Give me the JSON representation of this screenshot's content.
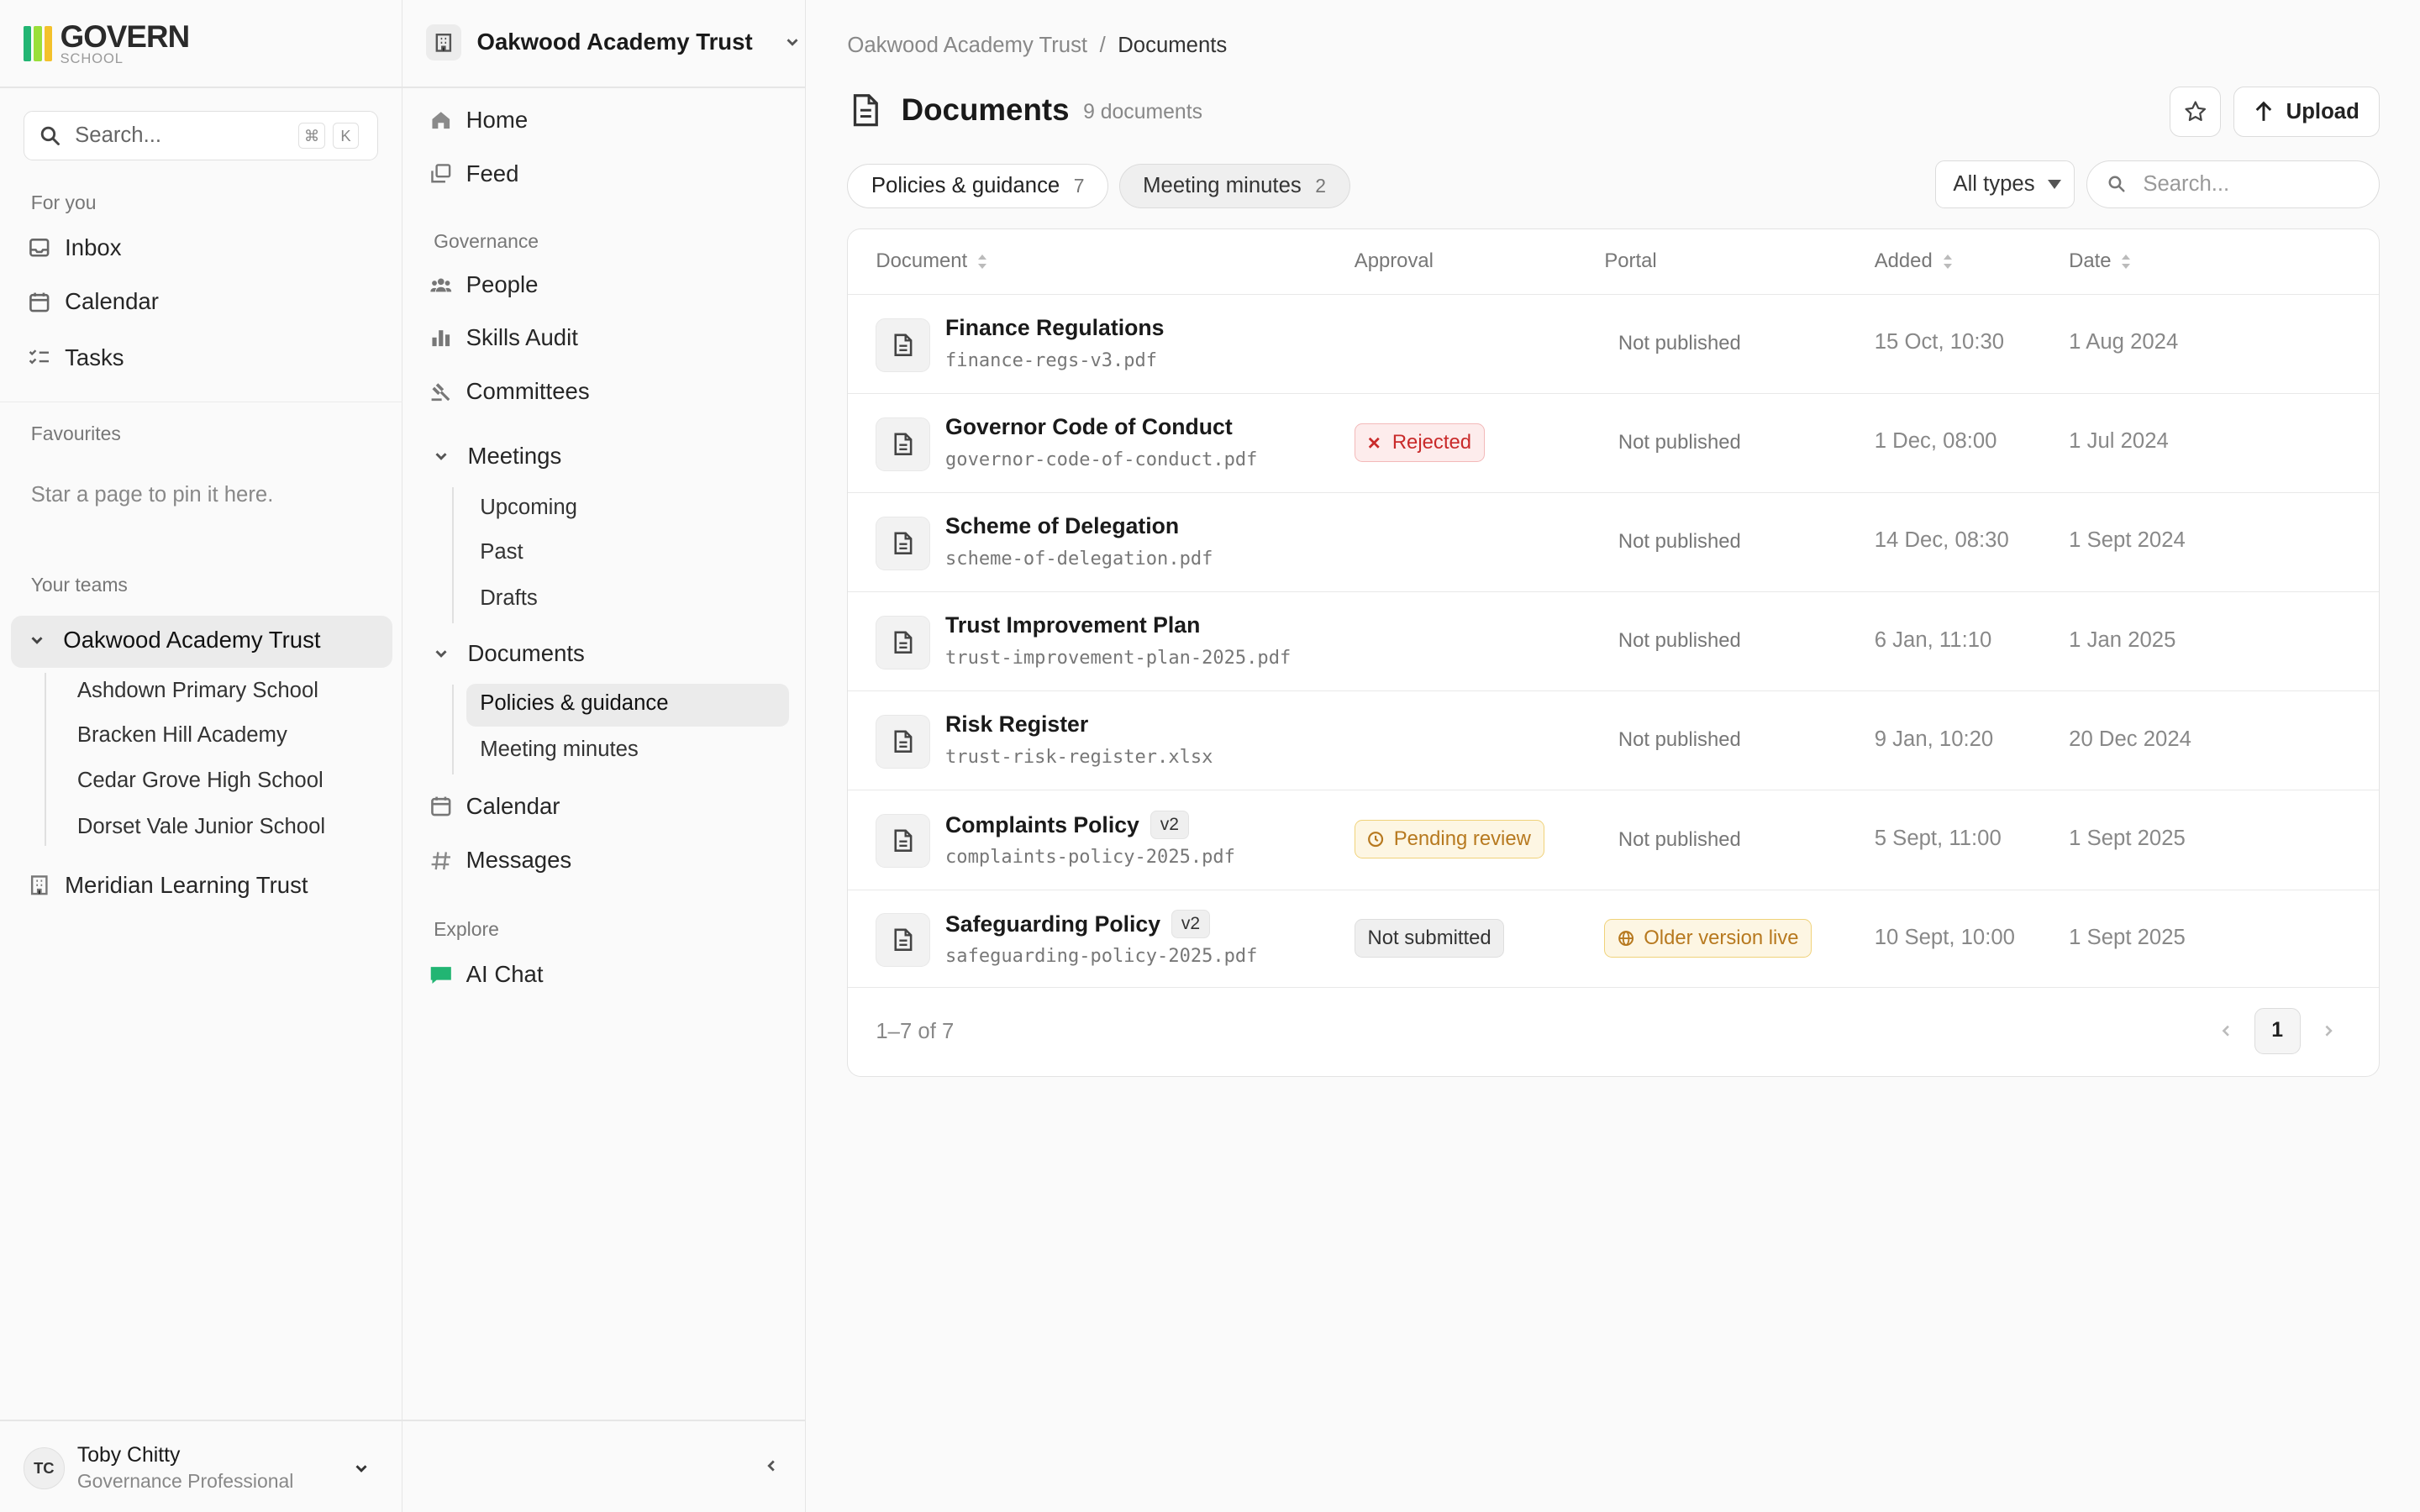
{
  "brand": {
    "name": "GOVERN",
    "sub": "SCHOOL",
    "colors": [
      "#22b573",
      "#9adf3a",
      "#f3c12b"
    ]
  },
  "search": {
    "placeholder": "Search...",
    "kbd1": "⌘",
    "kbd2": "K"
  },
  "sidebar": {
    "for_you_label": "For you",
    "for_you": [
      {
        "label": "Inbox",
        "icon": "inbox-icon"
      },
      {
        "label": "Calendar",
        "icon": "calendar-icon"
      },
      {
        "label": "Tasks",
        "icon": "tasks-icon"
      }
    ],
    "favourites_label": "Favourites",
    "favourites_empty": "Star a page to pin it here.",
    "teams_label": "Your teams",
    "teams": [
      {
        "label": "Oakwood Academy Trust",
        "expanded": true,
        "children": [
          "Ashdown Primary School",
          "Bracken Hill Academy",
          "Cedar Grove High School",
          "Dorset Vale Junior School"
        ]
      },
      {
        "label": "Meridian Learning Trust",
        "expanded": false
      }
    ]
  },
  "user": {
    "initials": "TC",
    "name": "Toby Chitty",
    "role": "Governance Professional"
  },
  "nav": {
    "org": "Oakwood Academy Trust",
    "top": [
      {
        "label": "Home",
        "icon": "home-icon"
      },
      {
        "label": "Feed",
        "icon": "feed-icon"
      }
    ],
    "governance_label": "Governance",
    "governance": [
      {
        "label": "People",
        "icon": "people-icon"
      },
      {
        "label": "Skills Audit",
        "icon": "chart-icon"
      },
      {
        "label": "Committees",
        "icon": "gavel-icon"
      }
    ],
    "meetings": {
      "label": "Meetings",
      "children": [
        "Upcoming",
        "Past",
        "Drafts"
      ]
    },
    "documents": {
      "label": "Documents",
      "children": [
        "Policies & guidance",
        "Meeting minutes"
      ],
      "selected": "Policies & guidance"
    },
    "bottom": [
      {
        "label": "Calendar",
        "icon": "calendar-icon"
      },
      {
        "label": "Messages",
        "icon": "hash-icon"
      }
    ],
    "explore_label": "Explore",
    "explore": [
      {
        "label": "AI Chat",
        "icon": "chat-icon"
      }
    ]
  },
  "breadcrumb": {
    "parent": "Oakwood Academy Trust",
    "sep": "/",
    "current": "Documents"
  },
  "page": {
    "title": "Documents",
    "count": "9 documents",
    "upload": "Upload"
  },
  "tabs": [
    {
      "label": "Policies & guidance",
      "count": "7"
    },
    {
      "label": "Meeting minutes",
      "count": "2"
    }
  ],
  "filters": {
    "type": "All types",
    "search_placeholder": "Search..."
  },
  "table": {
    "headers": {
      "document": "Document",
      "approval": "Approval",
      "portal": "Portal",
      "added": "Added",
      "date": "Date"
    },
    "rows": [
      {
        "name": "Finance Regulations",
        "version": "",
        "file": "finance-regs-v3.pdf",
        "approval": "",
        "approval_kind": "",
        "portal": "Not published",
        "portal_kind": "text",
        "added": "15 Oct, 10:30",
        "date": "1 Aug 2024"
      },
      {
        "name": "Governor Code of Conduct",
        "version": "",
        "file": "governor-code-of-conduct.pdf",
        "approval": "Rejected",
        "approval_kind": "red",
        "portal": "Not published",
        "portal_kind": "text",
        "added": "1 Dec, 08:00",
        "date": "1 Jul 2024"
      },
      {
        "name": "Scheme of Delegation",
        "version": "",
        "file": "scheme-of-delegation.pdf",
        "approval": "",
        "approval_kind": "",
        "portal": "Not published",
        "portal_kind": "text",
        "added": "14 Dec, 08:30",
        "date": "1 Sept 2024"
      },
      {
        "name": "Trust Improvement Plan",
        "version": "",
        "file": "trust-improvement-plan-2025.pdf",
        "approval": "",
        "approval_kind": "",
        "portal": "Not published",
        "portal_kind": "text",
        "added": "6 Jan, 11:10",
        "date": "1 Jan 2025"
      },
      {
        "name": "Risk Register",
        "version": "",
        "file": "trust-risk-register.xlsx",
        "approval": "",
        "approval_kind": "",
        "portal": "Not published",
        "portal_kind": "text",
        "added": "9 Jan, 10:20",
        "date": "20 Dec 2024"
      },
      {
        "name": "Complaints Policy",
        "version": "v2",
        "file": "complaints-policy-2025.pdf",
        "approval": "Pending review",
        "approval_kind": "amber",
        "portal": "Not published",
        "portal_kind": "text",
        "added": "5 Sept, 11:00",
        "date": "1 Sept 2025"
      },
      {
        "name": "Safeguarding Policy",
        "version": "v2",
        "file": "safeguarding-policy-2025.pdf",
        "approval": "Not submitted",
        "approval_kind": "gray",
        "portal": "Older version live",
        "portal_kind": "amber",
        "added": "10 Sept, 10:00",
        "date": "1 Sept 2025"
      }
    ],
    "range": "1–7 of 7",
    "page": "1"
  }
}
